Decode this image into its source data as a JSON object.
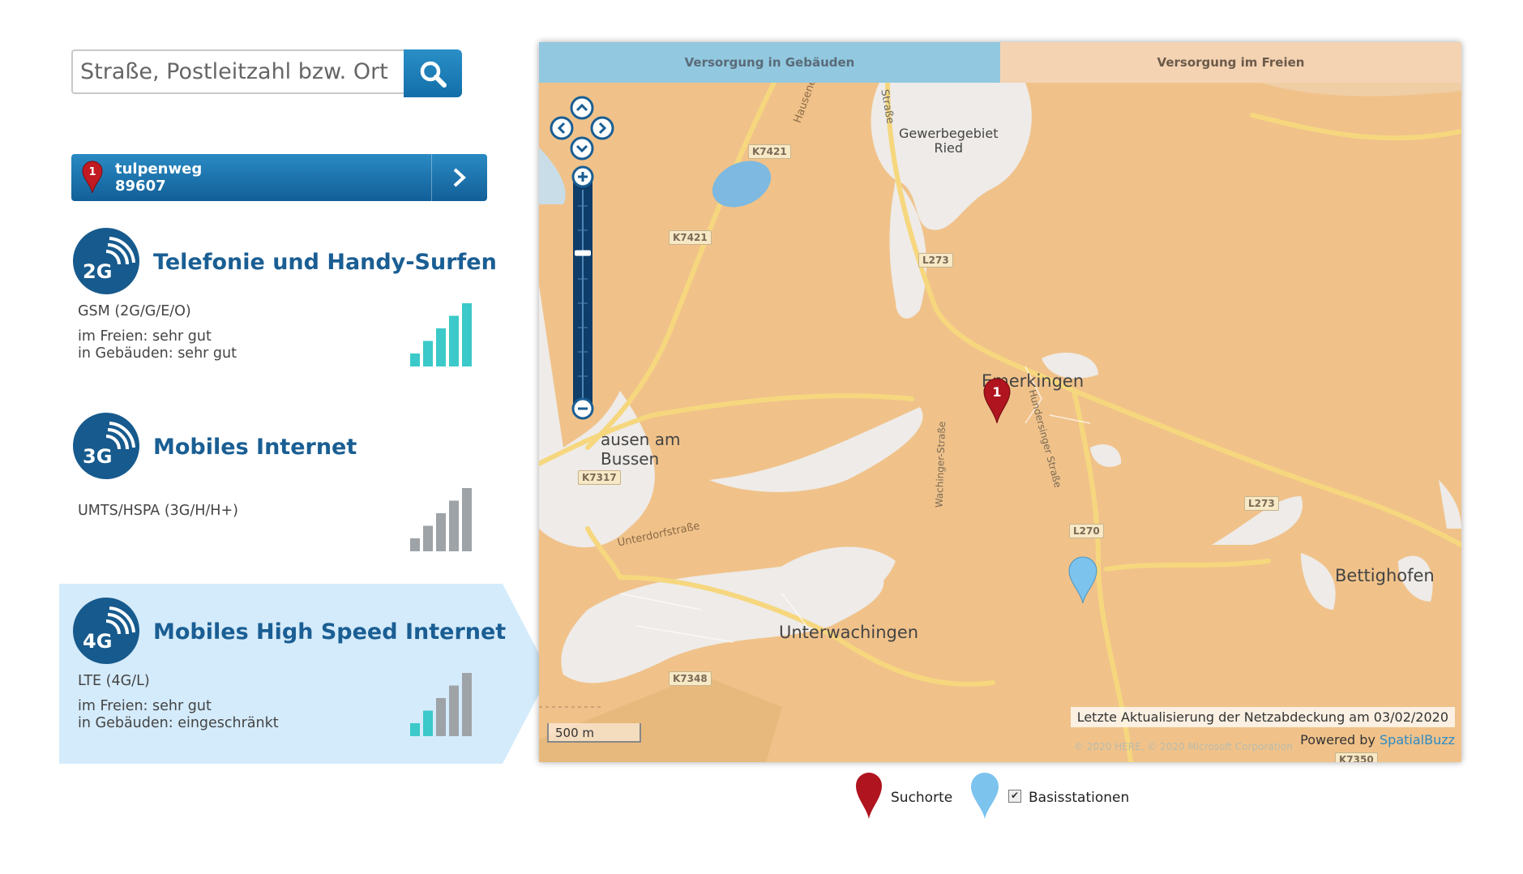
{
  "search": {
    "placeholder": "Straße, Postleitzahl bzw. Ort",
    "value": "",
    "button_icon": "search-icon"
  },
  "location": {
    "marker_number": "1",
    "street": "tulpenweg",
    "zip": "89607",
    "arrow_icon": "chevron-right-icon"
  },
  "services": [
    {
      "badge": "2G",
      "title": "Telefonie und Handy-Surfen",
      "tech": "GSM (2G/G/E/O)",
      "outdoor": "im Freien: sehr gut",
      "indoor": "in Gebäuden: sehr gut",
      "signal_level": 5
    },
    {
      "badge": "3G",
      "title": "Mobiles Internet",
      "tech": "UMTS/HSPA (3G/H/H+)",
      "outdoor": "",
      "indoor": "",
      "signal_level": 0
    },
    {
      "badge": "4G",
      "title": "Mobiles High Speed Internet",
      "tech": "LTE (4G/L)",
      "outdoor": "im Freien: sehr gut",
      "indoor": "in Gebäuden: eingeschränkt",
      "signal_level": 2,
      "selected": true
    }
  ],
  "map": {
    "tabs": [
      {
        "label": "Versorgung in Gebäuden",
        "active": true
      },
      {
        "label": "Versorgung im Freien",
        "active": false
      }
    ],
    "places": {
      "gewerbe1": "Gewerbegebiet",
      "gewerbe2": "Ried",
      "emerkingen": "Emerkingen",
      "hausen1": "ausen am",
      "hausen2": "Bussen",
      "unterwachingen": "Unterwachingen",
      "bettighofen": "Bettighofen"
    },
    "streets": {
      "hausen_str": "Hausene",
      "strasse": "Straße",
      "unterdorf": "Unterdorfstraße",
      "wachinger": "Wachinger-Straße",
      "hundersinger": "Hundersinger Straße"
    },
    "roads": [
      "K7421",
      "K7421",
      "L273",
      "K7317",
      "L270",
      "L273",
      "K7348",
      "K7350"
    ],
    "search_marker_label": "1",
    "attribution": "Letzte Aktualisierung der Netzabdeckung am 03/02/2020",
    "powered_prefix": "Powered by ",
    "powered_link": "SpatialBuzz",
    "copyright": "© 2020 HERE, © 2020 Microsoft Corporation",
    "scale_label": "500 m",
    "zoom_level": 0.3
  },
  "legend": {
    "search_label": "Suchorte",
    "stations_label": "Basisstationen",
    "stations_checked": true
  },
  "colors": {
    "brand_blue": "#1a5e93",
    "signal_on": "#3cc9c9",
    "signal_off": "#9ea3a8",
    "coverage_map": "#f0c28a",
    "tab_active": "#92c9e0",
    "marker_red": "#b0141f",
    "station_blue": "#7cc3ee"
  }
}
